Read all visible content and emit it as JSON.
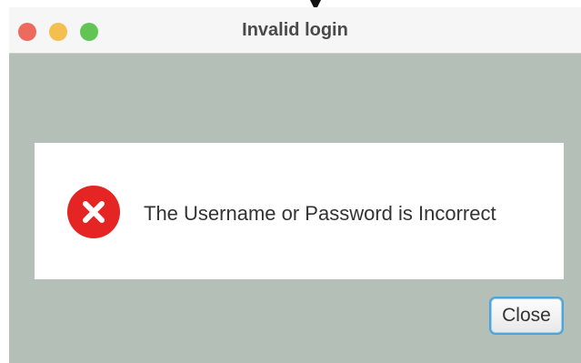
{
  "window": {
    "title": "Invalid login"
  },
  "dialog": {
    "icon": "error-x-circle-icon",
    "message": "The Username or Password is Incorrect",
    "close_label": "Close"
  },
  "colors": {
    "background": "#b4bfb8",
    "error_red": "#e52424",
    "button_focus": "#4fa3d6",
    "traffic_red": "#ed6a5e",
    "traffic_yellow": "#f5bf4f",
    "traffic_green": "#61c554"
  }
}
